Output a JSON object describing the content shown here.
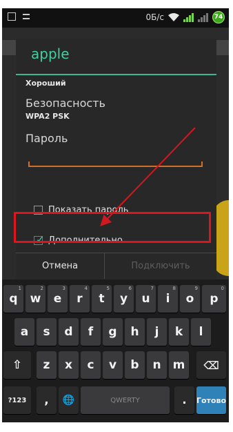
{
  "status_bar": {
    "speed": "0Б/с",
    "battery": "74"
  },
  "dialog": {
    "network_name": "apple",
    "signal_strength": "Хороший",
    "security_label": "Безопасность",
    "security_value": "WPA2 PSK",
    "password_label": "Пароль",
    "password_value": "",
    "show_password_label": "Показать пароль",
    "show_password_checked": false,
    "advanced_label": "Дополнительно",
    "advanced_checked": true,
    "cancel_label": "Отмена",
    "connect_label": "Подключить"
  },
  "annotation": {
    "highlight_color": "#e0141c",
    "accent_color": "#3fcfa0",
    "underline_color": "#d2702a"
  },
  "keyboard": {
    "row1": [
      {
        "label": "q",
        "hint": "1"
      },
      {
        "label": "w",
        "hint": "2"
      },
      {
        "label": "e",
        "hint": "3"
      },
      {
        "label": "r",
        "hint": "4"
      },
      {
        "label": "t",
        "hint": "5"
      },
      {
        "label": "y",
        "hint": "6"
      },
      {
        "label": "u",
        "hint": "7"
      },
      {
        "label": "i",
        "hint": "8"
      },
      {
        "label": "o",
        "hint": "9"
      },
      {
        "label": "p",
        "hint": "0"
      }
    ],
    "row2": [
      "a",
      "s",
      "d",
      "f",
      "g",
      "h",
      "j",
      "k",
      "l"
    ],
    "row3": [
      "z",
      "x",
      "c",
      "v",
      "b",
      "n",
      "m"
    ],
    "shift_icon": "⇧",
    "delete_icon": "⌫",
    "symbols_label": "?123",
    "comma_label": ",",
    "globe_icon": "🌐",
    "space_label": "QWERTY",
    "period_label": ".",
    "go_label": "Готово"
  }
}
